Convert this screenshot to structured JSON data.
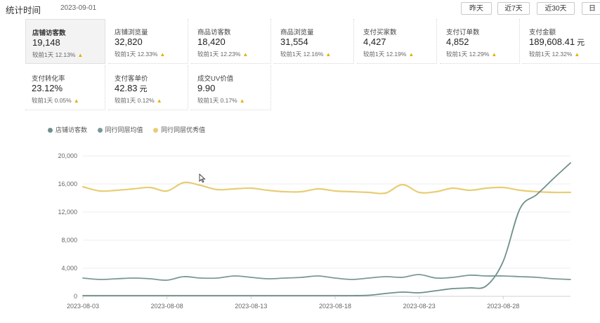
{
  "header": {
    "title": "统计时间",
    "date": "2023-09-01",
    "range_buttons": [
      "昨天",
      "近7天",
      "近30天",
      "日"
    ]
  },
  "metrics": [
    {
      "label": "店铺访客数",
      "value": "19,148",
      "compare": "较前1天 12.13%"
    },
    {
      "label": "店铺浏览量",
      "value": "32,820",
      "compare": "较前1天 12.33%"
    },
    {
      "label": "商品访客数",
      "value": "18,420",
      "compare": "较前1天 12.23%"
    },
    {
      "label": "商品浏览量",
      "value": "31,554",
      "compare": "较前1天 12.16%"
    },
    {
      "label": "支付买家数",
      "value": "4,427",
      "compare": "较前1天 12.19%"
    },
    {
      "label": "支付订单数",
      "value": "4,852",
      "compare": "较前1天 12.29%"
    },
    {
      "label": "支付金额",
      "value": "189,608.41",
      "unit": "元",
      "compare": "较前1天 12.32%"
    },
    {
      "label": "支付转化率",
      "value": "23.12%",
      "compare": "较前1天 0.05%"
    },
    {
      "label": "支付客单价",
      "value": "42.83",
      "unit": "元",
      "compare": "较前1天 0.12%"
    },
    {
      "label": "成交UV价值",
      "value": "9.90",
      "compare": "较前1天 0.17%"
    }
  ],
  "colors": {
    "series_shop": "#6e8f8a",
    "series_peer_avg": "#7a9996",
    "series_peer_excellent": "#e8cd74",
    "trend_up": "#e0b400"
  },
  "chart_data": {
    "type": "line",
    "x": [
      "2023-08-03",
      "2023-08-04",
      "2023-08-05",
      "2023-08-06",
      "2023-08-07",
      "2023-08-08",
      "2023-08-09",
      "2023-08-10",
      "2023-08-11",
      "2023-08-12",
      "2023-08-13",
      "2023-08-14",
      "2023-08-15",
      "2023-08-16",
      "2023-08-17",
      "2023-08-18",
      "2023-08-19",
      "2023-08-20",
      "2023-08-21",
      "2023-08-22",
      "2023-08-23",
      "2023-08-24",
      "2023-08-25",
      "2023-08-26",
      "2023-08-27",
      "2023-08-28",
      "2023-08-29",
      "2023-08-30",
      "2023-08-31",
      "2023-09-01"
    ],
    "xticks": [
      "2023-08-03",
      "2023-08-08",
      "2023-08-13",
      "2023-08-18",
      "2023-08-23",
      "2023-08-28"
    ],
    "yticks": [
      0,
      4000,
      8000,
      12000,
      16000,
      20000
    ],
    "ytick_labels": [
      "0",
      "4,000",
      "8,000",
      "12,000",
      "16,000",
      "20,000"
    ],
    "ylim": [
      0,
      20000
    ],
    "legend_position": "top-left",
    "series": [
      {
        "name": "店铺访客数",
        "color": "#6e8f8a",
        "values": [
          100,
          100,
          100,
          100,
          100,
          100,
          100,
          100,
          100,
          100,
          100,
          100,
          100,
          100,
          100,
          100,
          100,
          150,
          400,
          600,
          500,
          800,
          1100,
          1200,
          1500,
          5000,
          12500,
          14500,
          16800,
          19000
        ]
      },
      {
        "name": "同行同层均值",
        "color": "#7a9996",
        "values": [
          2600,
          2400,
          2500,
          2600,
          2500,
          2300,
          2800,
          2600,
          2600,
          2900,
          2700,
          2500,
          2600,
          2700,
          2900,
          2600,
          2400,
          2600,
          2800,
          2700,
          3100,
          2600,
          2700,
          3000,
          2900,
          2900,
          2800,
          2700,
          2500,
          2400
        ]
      },
      {
        "name": "同行同层优秀值",
        "color": "#e8cd74",
        "values": [
          15600,
          15000,
          15100,
          15300,
          15500,
          15000,
          16200,
          15800,
          15200,
          15300,
          15400,
          15100,
          14900,
          14900,
          15300,
          15000,
          14900,
          14800,
          14700,
          15900,
          14800,
          14900,
          15400,
          15100,
          15400,
          15500,
          15100,
          14900,
          14800,
          14800
        ]
      }
    ]
  }
}
